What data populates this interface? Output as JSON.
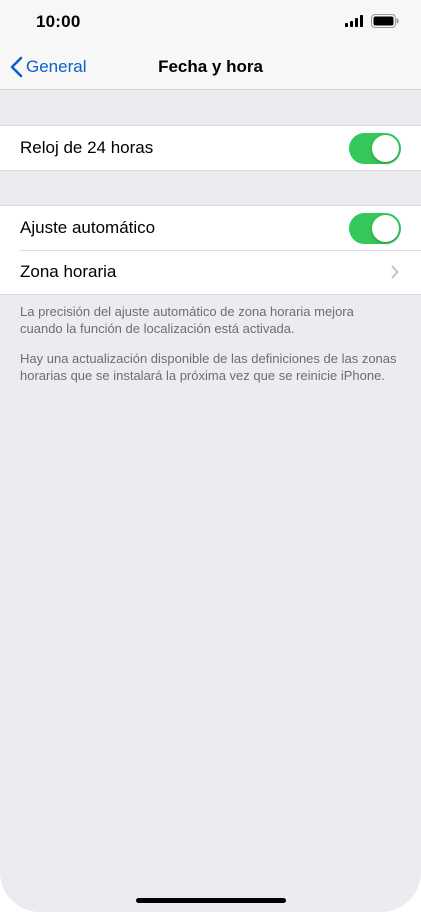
{
  "status_bar": {
    "time": "10:00",
    "signal_icon": "signal-bars-icon",
    "battery_icon": "battery-full-icon"
  },
  "nav": {
    "back_label": "General",
    "title": "Fecha y hora"
  },
  "settings": {
    "clock_24h": {
      "label": "Reloj de 24 horas",
      "enabled": true
    },
    "auto_set": {
      "label": "Ajuste automático",
      "enabled": true
    },
    "time_zone": {
      "label": "Zona horaria"
    }
  },
  "footnotes": {
    "location_note": "La precisión del ajuste automático de zona horaria mejora cuando la función de localización está activada.",
    "update_note": "Hay una actualización disponible de las definiciones de las zonas horarias que se instalará la próxima vez que se reinicie iPhone."
  },
  "colors": {
    "accent": "#0a60c9",
    "toggle_on": "#34c759",
    "background": "#ebebf0"
  }
}
